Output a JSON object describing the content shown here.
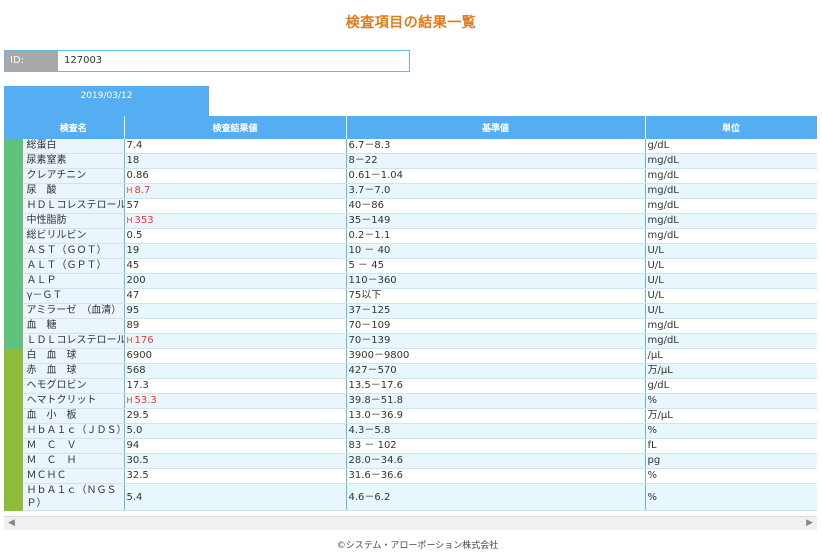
{
  "title": "検査項目の結果一覧",
  "patient": {
    "id_label": "ID:",
    "id_value": "127003"
  },
  "date_tab": "2019/03/12",
  "columns": {
    "item": "検査名",
    "result": "検査結果値",
    "reference": "基準値",
    "unit": "単位"
  },
  "colors": {
    "accent": "#55aef2",
    "title": "#e07b1a",
    "group1": "#5fc27c",
    "group2": "#8cbc3a",
    "high": "#e03a3a"
  },
  "groups": [
    {
      "color": "#5fc27c",
      "rows": [
        {
          "name": "総蛋白",
          "flag": "",
          "value": "7.4",
          "ref": "6.7－8.3",
          "unit": "g/dL"
        },
        {
          "name": "尿素窒素",
          "flag": "",
          "value": "18",
          "ref": "8－22",
          "unit": "mg/dL"
        },
        {
          "name": "クレアチニン",
          "flag": "",
          "value": "0.86",
          "ref": "0.61－1.04",
          "unit": "mg/dL"
        },
        {
          "name": "尿　酸",
          "flag": "H",
          "value": "8.7",
          "ref": "3.7－7.0",
          "unit": "mg/dL"
        },
        {
          "name": "ＨＤＬコレステロール",
          "flag": "",
          "value": "57",
          "ref": "40－86",
          "unit": "mg/dL"
        },
        {
          "name": "中性脂肪",
          "flag": "H",
          "value": "353",
          "ref": "35－149",
          "unit": "mg/dL"
        },
        {
          "name": "総ビリルビン",
          "flag": "",
          "value": "0.5",
          "ref": "0.2－1.1",
          "unit": "mg/dL"
        },
        {
          "name": "ＡＳＴ（ＧＯＴ）",
          "flag": "",
          "value": "19",
          "ref": "10 － 40",
          "unit": "U/L"
        },
        {
          "name": "ＡＬＴ（ＧＰＴ）",
          "flag": "",
          "value": "45",
          "ref": "5 － 45",
          "unit": "U/L"
        },
        {
          "name": "ＡＬＰ",
          "flag": "",
          "value": "200",
          "ref": "110－360",
          "unit": "U/L"
        },
        {
          "name": "γ－ＧＴ",
          "flag": "",
          "value": "47",
          "ref": "75以下",
          "unit": "U/L"
        },
        {
          "name": "アミラーゼ　（血清）",
          "flag": "",
          "value": "95",
          "ref": "37－125",
          "unit": "U/L"
        },
        {
          "name": "血　糖",
          "flag": "",
          "value": "89",
          "ref": "70－109",
          "unit": "mg/dL"
        },
        {
          "name": "ＬＤＬコレステロール",
          "flag": "H",
          "value": "176",
          "ref": "70－139",
          "unit": "mg/dL"
        }
      ]
    },
    {
      "color": "#8cbc3a",
      "rows": [
        {
          "name": "白　血　球",
          "flag": "",
          "value": "6900",
          "ref": "3900－9800",
          "unit": "/μL"
        },
        {
          "name": "赤　血　球",
          "flag": "",
          "value": "568",
          "ref": "427－570",
          "unit": "万/μL"
        },
        {
          "name": "ヘモグロビン",
          "flag": "",
          "value": "17.3",
          "ref": "13.5－17.6",
          "unit": "g/dL"
        },
        {
          "name": "ヘマトクリット",
          "flag": "H",
          "value": "53.3",
          "ref": "39.8－51.8",
          "unit": "%"
        },
        {
          "name": "血　小　板",
          "flag": "",
          "value": "29.5",
          "ref": "13.0－36.9",
          "unit": "万/μL"
        },
        {
          "name": "ＨｂＡ１ｃ（ＪＤＳ）",
          "flag": "",
          "value": "5.0",
          "ref": "4.3－5.8",
          "unit": "%"
        },
        {
          "name": "Ｍ　Ｃ　Ｖ",
          "flag": "",
          "value": "94",
          "ref": "83 － 102",
          "unit": "fL"
        },
        {
          "name": "Ｍ　Ｃ　Ｈ",
          "flag": "",
          "value": "30.5",
          "ref": "28.0－34.6",
          "unit": "pg"
        },
        {
          "name": "ＭＣＨＣ",
          "flag": "",
          "value": "32.5",
          "ref": "31.6－36.6",
          "unit": "%"
        },
        {
          "name": "ＨｂＡ１ｃ（ＮＧＳＰ）",
          "flag": "",
          "value": "5.4",
          "ref": "4.6－6.2",
          "unit": "%"
        }
      ]
    }
  ],
  "footer": "©システム・アローポーション株式会社"
}
